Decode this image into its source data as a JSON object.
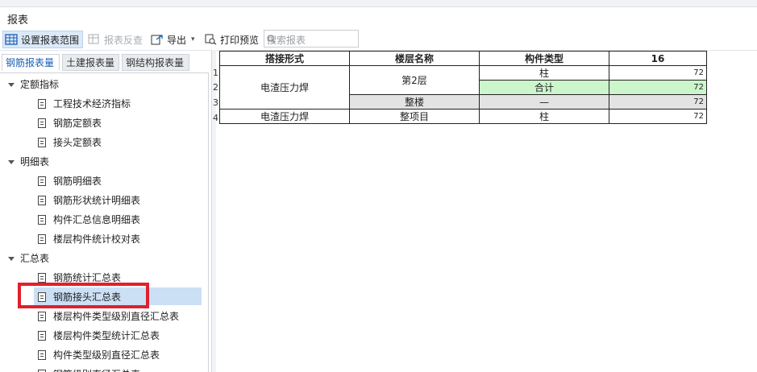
{
  "panel_title": "报表",
  "toolbar": {
    "set_range": "设置报表范围",
    "reverse_check": "报表反查",
    "export": "导出",
    "print_preview": "打印预览",
    "search_placeholder": "搜索报表"
  },
  "tabs": [
    {
      "label": "钢筋报表量",
      "active": true
    },
    {
      "label": "土建报表量",
      "active": false
    },
    {
      "label": "钢结构报表量",
      "active": false
    }
  ],
  "tree": {
    "groups": [
      {
        "label": "定额指标",
        "items": [
          "工程技术经济指标",
          "钢筋定额表",
          "接头定额表"
        ]
      },
      {
        "label": "明细表",
        "items": [
          "钢筋明细表",
          "钢筋形状统计明细表",
          "构件汇总信息明细表",
          "楼层构件统计校对表"
        ]
      },
      {
        "label": "汇总表",
        "items": [
          "钢筋统计汇总表",
          "钢筋接头汇总表",
          "楼层构件类型级别直径汇总表",
          "楼层构件类型统计汇总表",
          "构件类型级别直径汇总表",
          "钢筋级别直径汇总表"
        ]
      }
    ],
    "selected": "钢筋接头汇总表"
  },
  "report": {
    "headers": [
      "搭接形式",
      "楼层名称",
      "构件类型",
      "16"
    ],
    "row_numbers": [
      "1",
      "2",
      "3",
      "4"
    ],
    "rows": [
      {
        "form": "电渣压力焊",
        "floor": "第2层",
        "type": "柱",
        "value": "72"
      },
      {
        "form": "",
        "floor": "",
        "type": "合计",
        "value": "72"
      },
      {
        "form": "",
        "floor": "整楼",
        "type": "—",
        "value": "72"
      },
      {
        "form": "电渣压力焊",
        "floor": "整项目",
        "type": "柱",
        "value": "72"
      }
    ]
  },
  "colors": {
    "highlight_box": "#e0202c",
    "selected_row": "#cce0f5",
    "total_green": "#ccf5cc",
    "whole_grey": "#e3e3e3"
  }
}
